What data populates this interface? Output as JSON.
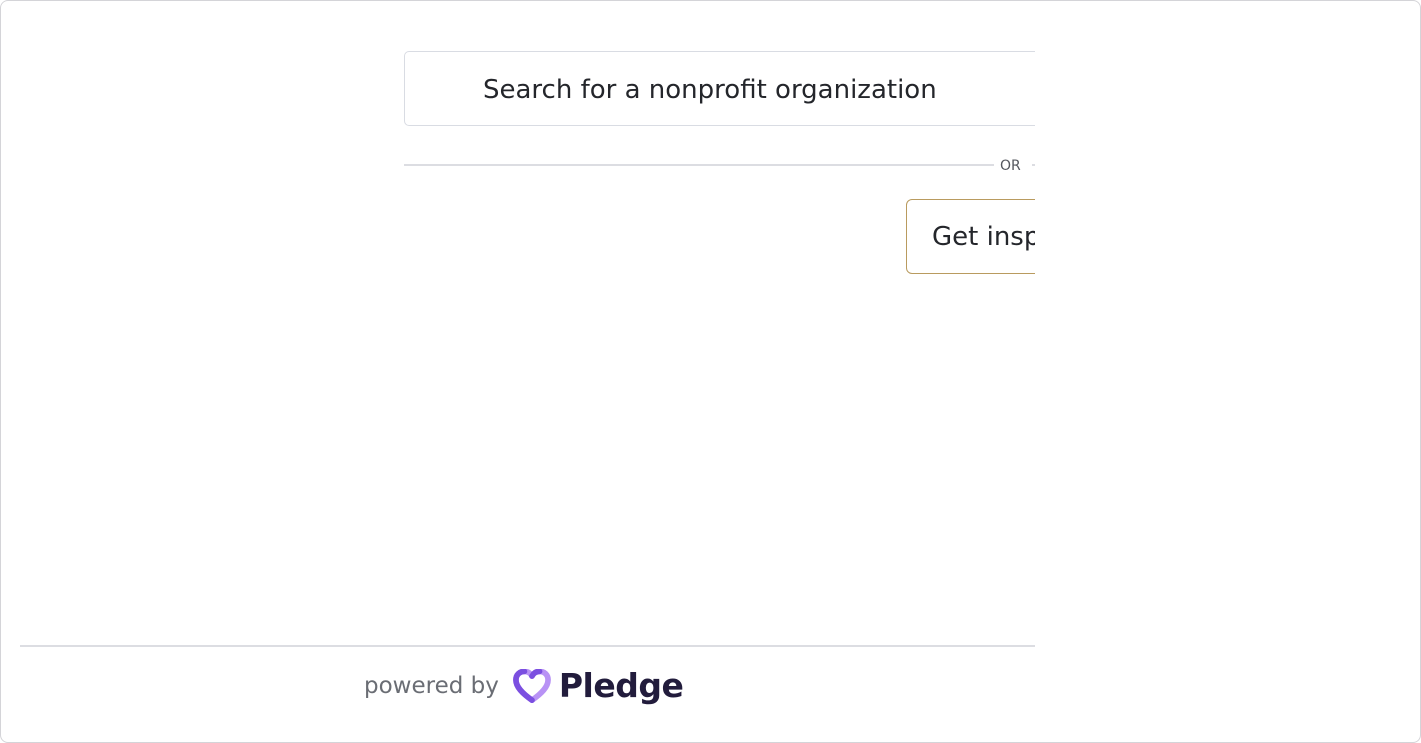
{
  "search": {
    "placeholder": "Search for a nonprofit organization"
  },
  "divider": {
    "label": "OR"
  },
  "inspire_button": {
    "label": "Get insp"
  },
  "footer": {
    "powered_by": "powered by",
    "brand": "Pledge",
    "brand_icon": "heart-icon"
  },
  "colors": {
    "brand_text": "#221c3c",
    "heart_light": "#b892f5",
    "heart_dark": "#7b4fe0",
    "button_border": "#b99b5f",
    "border": "#d9dce3"
  }
}
